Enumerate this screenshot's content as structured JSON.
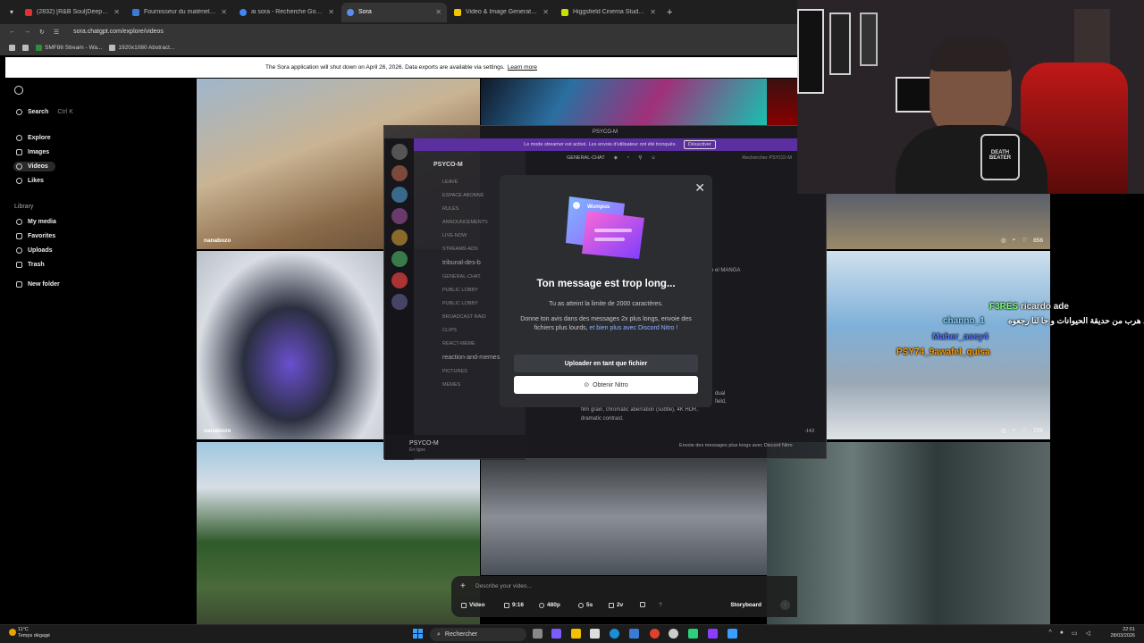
{
  "browser": {
    "tabs": [
      {
        "label": "(2832) [R&B Soul]Deep Ch",
        "color": "#e03030",
        "active": false
      },
      {
        "label": "Fournisseur du matériel Audio",
        "color": "#3a7bd5",
        "active": false
      },
      {
        "label": "ai sora - Recherche Google",
        "color": "#4285f4",
        "active": false
      },
      {
        "label": "Sora",
        "color": "#5a8ef0",
        "active": true
      },
      {
        "label": "Video & Image Generation - A",
        "color": "#f5c400",
        "active": false
      },
      {
        "label": "Higgsfield Cinema Studio | Pro",
        "color": "#c8e000",
        "active": false
      }
    ],
    "url": "sora.chatgpt.com/explore/videos",
    "bookmarks": [
      "SMF86 Stream - Wa...",
      "1920x1080 Abstract..."
    ]
  },
  "banner": {
    "text": "The Sora application will shut down on April 26, 2026. Data exports are available via settings.",
    "link": "Learn more"
  },
  "sidebar": {
    "search": "Search",
    "search_shortcut": "Ctrl K",
    "nav": [
      "Explore",
      "Images",
      "Videos",
      "Likes"
    ],
    "library_heading": "Library",
    "library": [
      "My media",
      "Favorites",
      "Uploads",
      "Trash"
    ],
    "new_folder": "New folder"
  },
  "grid": {
    "tiles": [
      {
        "author": "nanabozo"
      },
      {
        "author": "nanabozo"
      },
      {
        "author": "",
        "views": "856"
      },
      {
        "author": "",
        "views": "725"
      }
    ]
  },
  "discord": {
    "window_title": "PSYCO-M",
    "streamer_notice": "Le mode streamer est activé. Les envois d'utilisateur ont été tronqués.",
    "streamer_button": "Désactiver",
    "server_name": "PSYCO-M",
    "channel_header": "GENERAL-CHAT",
    "search_placeholder": "Rechercher PSYCO-M",
    "channels": [
      "LEAVE",
      "ESPACE ABONNÉ",
      "RULES",
      "ANNOUNCEMENTS",
      "LIVE-NOW",
      "STREAMS-ADS",
      "tribunal-des-b",
      "GENERAL-CHAT",
      "PUBLIC LOBBY",
      "PUBLIC LOBBY",
      "BROADCAST RAID",
      "CLIPS",
      "REACT-MEME",
      "reaction-and-memes",
      "PICTURES",
      "MEMES"
    ],
    "user_name": "PSYCO-M",
    "user_status": "En ligne",
    "chat_fragment_1": "teb el MANGA",
    "chat_fragment_2": "dual",
    "chat_fragment_3": "field,",
    "chat_fragment_4": "film grain, chromatic aberration (subtle), 4K HDR,",
    "chat_fragment_5": "dramatic contrast.",
    "send_hint": "Envoie des messages plus longs avec Discord Nitro",
    "char_count": "-143"
  },
  "modal": {
    "art_label": "Wumpus",
    "title": "Ton message est trop long...",
    "subtitle": "Tu as atteint la limite de 2000 caractères.",
    "body": "Donne ton avis dans des messages 2x plus longs, envoie des fichiers plus lourds,",
    "body_link": "et bien plus avec Discord Nitro !",
    "upload_button": "Uploader en tant que fichier",
    "nitro_button": "Obtenir Nitro"
  },
  "promptbar": {
    "placeholder": "Describe your video...",
    "chips": [
      "Video",
      "9:16",
      "480p",
      "5s",
      "2v"
    ],
    "storyboard": "Storyboard"
  },
  "stream_chat": [
    {
      "text": "ricardo ade",
      "color": "#ffffff"
    },
    {
      "text": "F3RES",
      "color": "#7cff7c"
    },
    {
      "text": "channo_1",
      "color": "#7fd0ff"
    },
    {
      "text": "قرد هرب من حديقة الحيوانات و جا لنا رجعوه",
      "color": "#ffffff"
    },
    {
      "text": "Maher_assy4",
      "color": "#5577ff"
    },
    {
      "text": "PSY74_9awafel_quisa",
      "color": "#ff9a00"
    }
  ],
  "overlay_brand": "DEATH BEATER",
  "taskbar": {
    "temperature": "11°C",
    "weather": "Temps dégagé",
    "search": "Rechercher",
    "time": "22:51",
    "date": "28/03/2026"
  }
}
